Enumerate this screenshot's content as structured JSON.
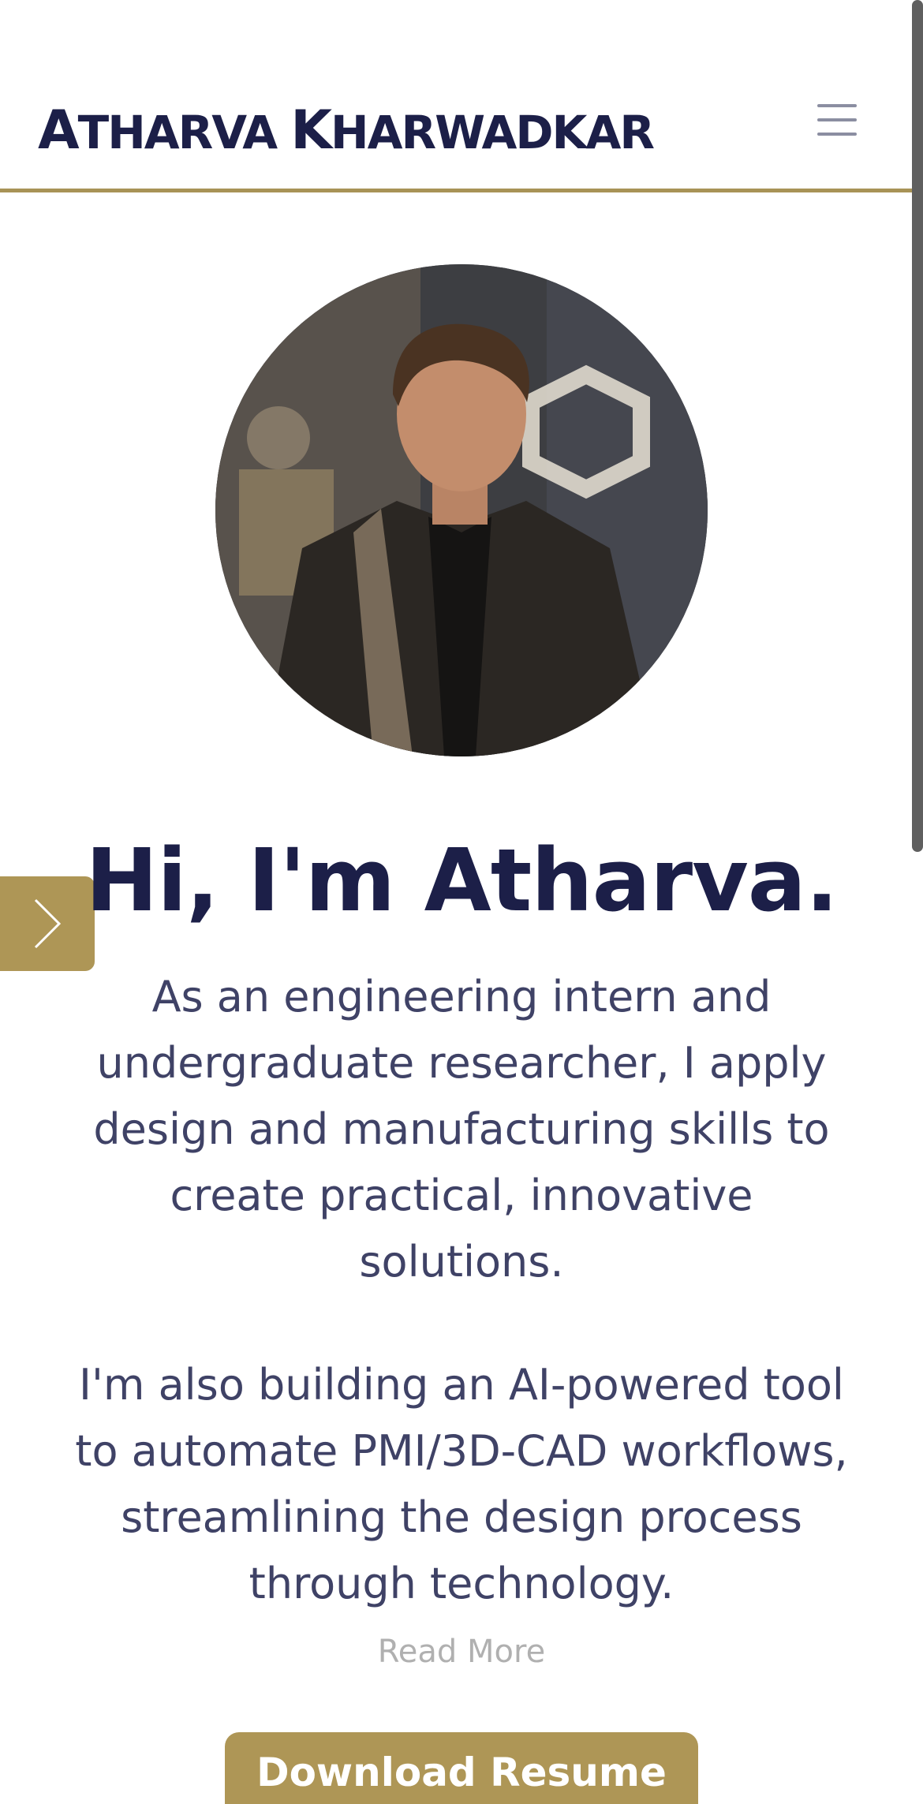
{
  "header": {
    "brand_first": "A",
    "brand_first_rest": "THARVA",
    "brand_last": "K",
    "brand_last_rest": "HARWADKAR",
    "menu_icon": "hamburger-menu-icon"
  },
  "hero": {
    "avatar_alt": "Portrait photo",
    "title": "Hi, I'm Atharva.",
    "paragraph1": "As an engineering intern and undergraduate researcher, I apply design and manufacturing skills to create practical, innovative solutions.",
    "paragraph2": "I'm also building an AI-powered tool to automate PMI/3D-CAD workflows, streamlining the design process through technology.",
    "read_more": "Read More",
    "download_label": "Download Resume"
  },
  "side_tab": {
    "icon": "chevron-right-icon"
  },
  "colors": {
    "navy": "#1c1f48",
    "gold": "#ae9656",
    "text": "#3f4266",
    "muted": "#b0b0b0"
  }
}
